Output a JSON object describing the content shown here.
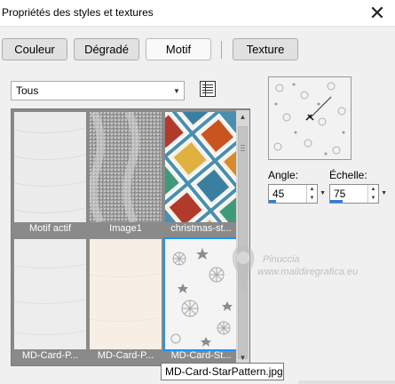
{
  "window": {
    "title": "Propriétés des styles et textures"
  },
  "tabs": [
    {
      "label": "Couleur"
    },
    {
      "label": "Dégradé"
    },
    {
      "label": "Motif"
    },
    {
      "label": "Texture"
    }
  ],
  "category": {
    "value": "Tous"
  },
  "gallery": {
    "items": [
      {
        "label": "Motif actif"
      },
      {
        "label": "Image1"
      },
      {
        "label": "christmas-st..."
      },
      {
        "label": "MD-Card-P..."
      },
      {
        "label": "MD-Card-P..."
      },
      {
        "label": "MD-Card-St..."
      }
    ],
    "selected_index": 5
  },
  "angle": {
    "label": "Angle:",
    "value": "45"
  },
  "scale": {
    "label": "Échelle:",
    "value": "75"
  },
  "tooltip": {
    "text": "MD-Card-StarPattern.jpg"
  },
  "watermark": {
    "name": "Pinuccia",
    "url": "www.maildiregrafica.eu"
  },
  "colors": {
    "accent": "#2a7fdf",
    "gallery_bg": "#8a8a8a",
    "selection": "#1e90ff"
  }
}
